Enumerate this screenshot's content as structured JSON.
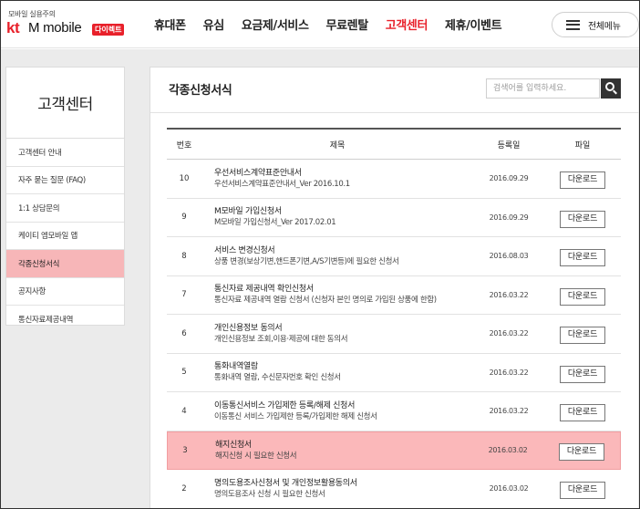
{
  "brand": {
    "tagline": "모바일 실용주의",
    "logo_kt": "kt",
    "logo_name": "M mobile",
    "badge": "다이렉트"
  },
  "nav": {
    "items": [
      "휴대폰",
      "유심",
      "요금제/서비스",
      "무료렌탈",
      "고객센터",
      "제휴/이벤트"
    ],
    "active": "고객센터",
    "all_menu_label": "전체메뉴"
  },
  "sidebar": {
    "title": "고객센터",
    "items": [
      "고객센터 안내",
      "자주 묻는 질문 (FAQ)",
      "1:1 상담문의",
      "케이티 엠모바일 앱",
      "각종신청서식",
      "공지사항",
      "통신자료제공내역"
    ],
    "active_index": 4
  },
  "main": {
    "title": "각종신청서식",
    "search_placeholder": "검색어를 입력하세요."
  },
  "table": {
    "headers": {
      "no": "번호",
      "title": "제목",
      "date": "등록일",
      "file": "파일"
    },
    "download_label": "다운로드",
    "highlight_index": 7,
    "rows": [
      {
        "no": "10",
        "title": "우선서비스계약표준안내서",
        "subtitle": "우선서비스계약표준안내서_Ver 2016.10.1",
        "date": "2016.09.29"
      },
      {
        "no": "9",
        "title": "M모바일 가입신청서",
        "subtitle": "M모바일 가입신청서_Ver 2017.02.01",
        "date": "2016.09.29"
      },
      {
        "no": "8",
        "title": "서비스 변경신청서",
        "subtitle": "상품 변경(보상기변,핸드폰기변,A/S기변등)에 필요한 신청서",
        "date": "2016.08.03"
      },
      {
        "no": "7",
        "title": "통신자료 제공내역 확인신청서",
        "subtitle": "통신자료 제공내역 열람 신청서 (신청자 본인 명의로 가입된 상품에 한함)",
        "date": "2016.03.22"
      },
      {
        "no": "6",
        "title": "개인신용정보 동의서",
        "subtitle": "개인신용정보 조회,이용·제공에 대한 동의서",
        "date": "2016.03.22"
      },
      {
        "no": "5",
        "title": "통화내역열람",
        "subtitle": "통화내역 열람, 수신문자번호 확인 신청서",
        "date": "2016.03.22"
      },
      {
        "no": "4",
        "title": "이동통신서비스 가입제한 등록/해제 신청서",
        "subtitle": "이동통신 서비스 가입제한 등록/가입제한 해제 신청서",
        "date": "2016.03.22"
      },
      {
        "no": "3",
        "title": "해지신청서",
        "subtitle": "해지신청 시 필요한 신청서",
        "date": "2016.03.02"
      },
      {
        "no": "2",
        "title": "명의도용조사신청서 및 개인정보활용동의서",
        "subtitle": "명의도용조사 신청 시 필요한 신청서",
        "date": "2016.03.02"
      }
    ]
  },
  "colors": {
    "brand_red": "#e8202a",
    "highlight": "#fbb8ba",
    "background_grey": "#ebebeb"
  }
}
